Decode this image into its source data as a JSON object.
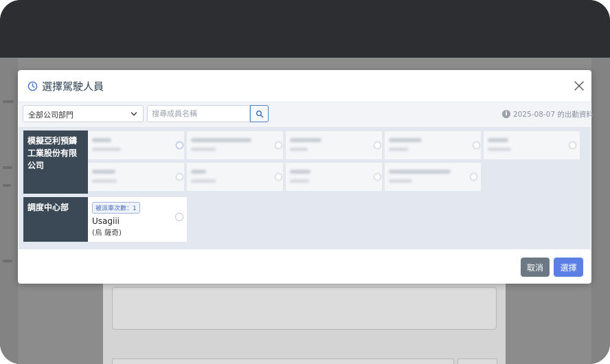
{
  "modal": {
    "title": "選擇駕駛人員",
    "title_icon": "clock-icon",
    "close_icon": "close-icon"
  },
  "toolbar": {
    "department_select": "全部公司部門",
    "search_placeholder": "搜尋成員名稱",
    "search_icon": "search-icon",
    "date_info": "2025-08-07 的出勤資料"
  },
  "groups": [
    {
      "label": "模擬亞利預鑄工業股份有限公司"
    },
    {
      "label": "調度中心部"
    }
  ],
  "dispatch_card": {
    "badge": "被派車次數：1",
    "name": "Usagiii",
    "sub": "(烏 薩奇)"
  },
  "footer": {
    "cancel_label": "取消",
    "confirm_label": "選擇"
  },
  "colors": {
    "primary": "#5b7fe5",
    "cancel": "#6c7884",
    "group_label_bg": "#3b4856",
    "body_bg": "#e2e7f0"
  }
}
